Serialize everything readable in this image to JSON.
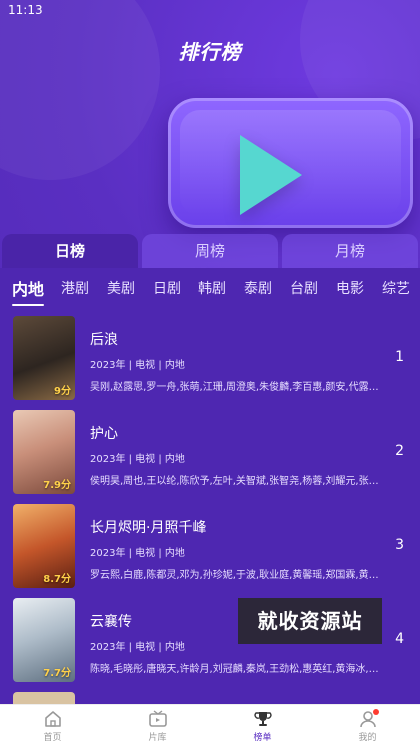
{
  "status_bar": {
    "time": "11:13"
  },
  "header": {
    "title": "排行榜"
  },
  "period_tabs": [
    {
      "label": "日榜",
      "active": true
    },
    {
      "label": "周榜",
      "active": false
    },
    {
      "label": "月榜",
      "active": false
    }
  ],
  "region_tabs": [
    {
      "label": "内地",
      "active": true
    },
    {
      "label": "港剧"
    },
    {
      "label": "美剧"
    },
    {
      "label": "日剧"
    },
    {
      "label": "韩剧"
    },
    {
      "label": "泰剧"
    },
    {
      "label": "台剧"
    },
    {
      "label": "电影"
    },
    {
      "label": "综艺"
    }
  ],
  "rank_list": [
    {
      "rank": "1",
      "title": "后浪",
      "meta": "2023年 | 电视 | 内地",
      "cast": "吴刚,赵露思,罗一舟,张萌,江珊,周澄奥,朱俊麟,李百惠,颜安,代露…",
      "score": "9分"
    },
    {
      "rank": "2",
      "title": "护心",
      "meta": "2023年 | 电视 | 内地",
      "cast": "侯明昊,周也,王以纶,陈欣予,左叶,关智斌,张智尧,杨蓉,刘耀元,张…",
      "score": "7.9分"
    },
    {
      "rank": "3",
      "title": "长月烬明·月照千峰",
      "meta": "2023年 | 电视 | 内地",
      "cast": "罗云熙,白鹿,陈都灵,邓为,孙珍妮,于波,耿业庭,黄馨瑶,郑国霖,黄…",
      "score": "8.7分"
    },
    {
      "rank": "4",
      "title": "云襄传",
      "meta": "2023年 | 电视 | 内地",
      "cast": "陈晓,毛晓彤,唐晓天,许龄月,刘冠麟,秦岚,王劲松,惠英红,黄海冰,…",
      "score": "7.7分"
    }
  ],
  "watermark": {
    "text": "就收资源站"
  },
  "bottom_nav": [
    {
      "label": "首页",
      "icon": "home-icon"
    },
    {
      "label": "片库",
      "icon": "tv-icon"
    },
    {
      "label": "榜单",
      "icon": "trophy-icon",
      "active": true
    },
    {
      "label": "我的",
      "icon": "user-icon"
    }
  ],
  "colors": {
    "brand": "#5a2fc2",
    "play": "#56d7d0",
    "score": "#ffd14a"
  }
}
